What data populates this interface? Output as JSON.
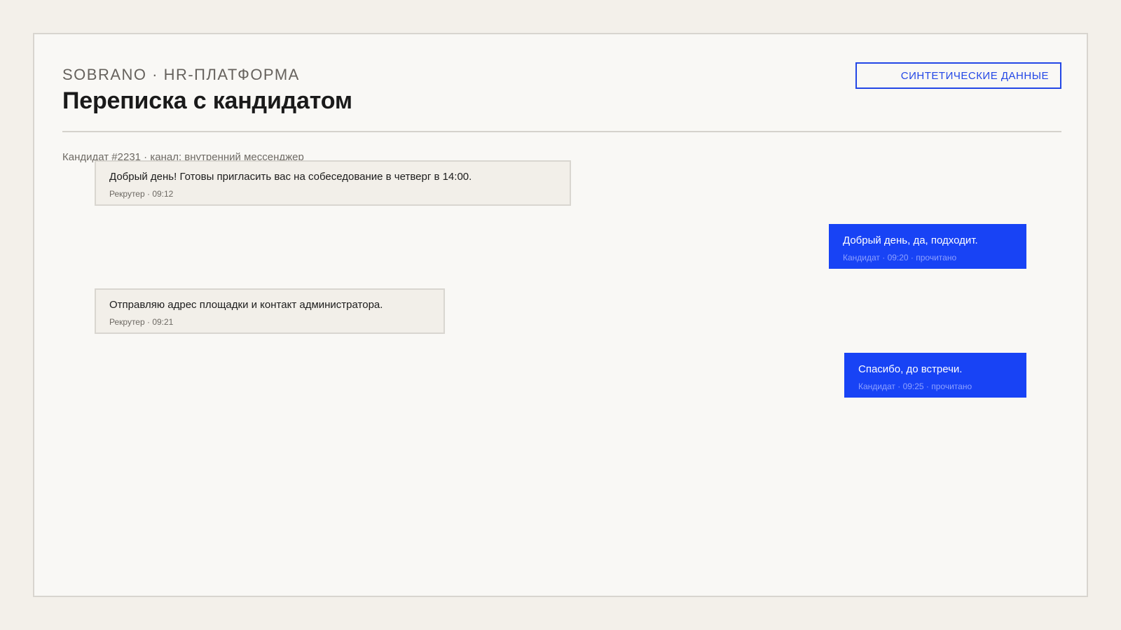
{
  "header": {
    "brand": "SOBRANO · HR-ПЛАТФОРМА",
    "title": "Переписка с кандидатом",
    "badge": "СИНТЕТИЧЕСКИЕ ДАННЫЕ"
  },
  "conversation": {
    "meta": "Кандидат #2231 · канал: внутренний мессенджер",
    "messages": [
      {
        "direction": "incoming",
        "text": "Добрый день! Готовы пригласить вас на собеседование в четверг в 14:00.",
        "sub": "Рекрутер · 09:12"
      },
      {
        "direction": "outgoing",
        "text": "Добрый день, да, подходит.",
        "sub": "Кандидат · 09:20 · прочитано"
      },
      {
        "direction": "incoming",
        "text": "Отправляю адрес площадки и контакт администратора.",
        "sub": "Рекрутер · 09:21"
      },
      {
        "direction": "outgoing",
        "text": "Спасибо, до встречи.",
        "sub": "Кандидат · 09:25 · прочитано"
      }
    ]
  },
  "colors": {
    "accent": "#1843f5",
    "badge_border": "#2347e6",
    "page_background": "#f3f0ea",
    "panel_background": "#f9f8f5",
    "incoming_bubble": "#f2efe9"
  }
}
